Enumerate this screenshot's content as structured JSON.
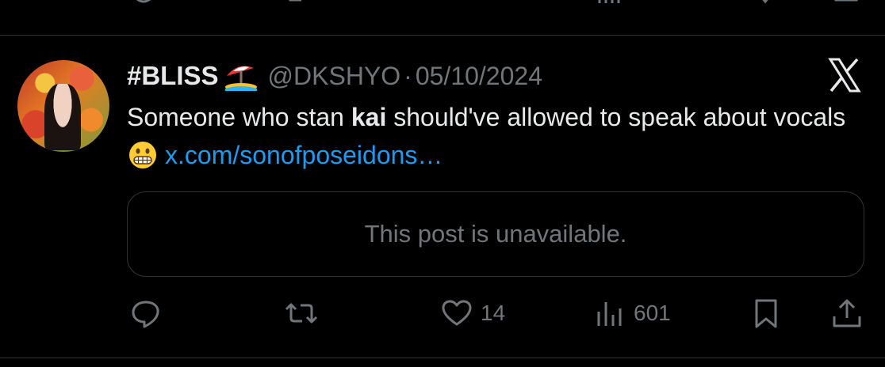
{
  "post": {
    "display_name": "#BLISS",
    "name_emoji": "beach-umbrella-emoji",
    "handle": "@DKSHYO",
    "separator": "·",
    "date": "05/10/2024",
    "platform_icon": "x-logo-icon",
    "text_before": "Someone who stan ",
    "text_bold": "kai",
    "text_after": " should've allowed to speak about vocals",
    "text_emoji": "grimacing-face-emoji",
    "link_text": "x.com/sonofposeidons…",
    "quote_unavailable": "This post is unavailable."
  },
  "actions": {
    "reply_icon": "reply-icon",
    "repost_icon": "repost-icon",
    "like_icon": "heart-icon",
    "like_count": "14",
    "views_icon": "views-bar-chart-icon",
    "views_count": "601",
    "bookmark_icon": "bookmark-icon",
    "share_icon": "share-icon"
  },
  "colors": {
    "background": "#000000",
    "text": "#e7e9ea",
    "secondary": "#71767b",
    "link": "#1d9bf0",
    "border": "#2f3336"
  }
}
